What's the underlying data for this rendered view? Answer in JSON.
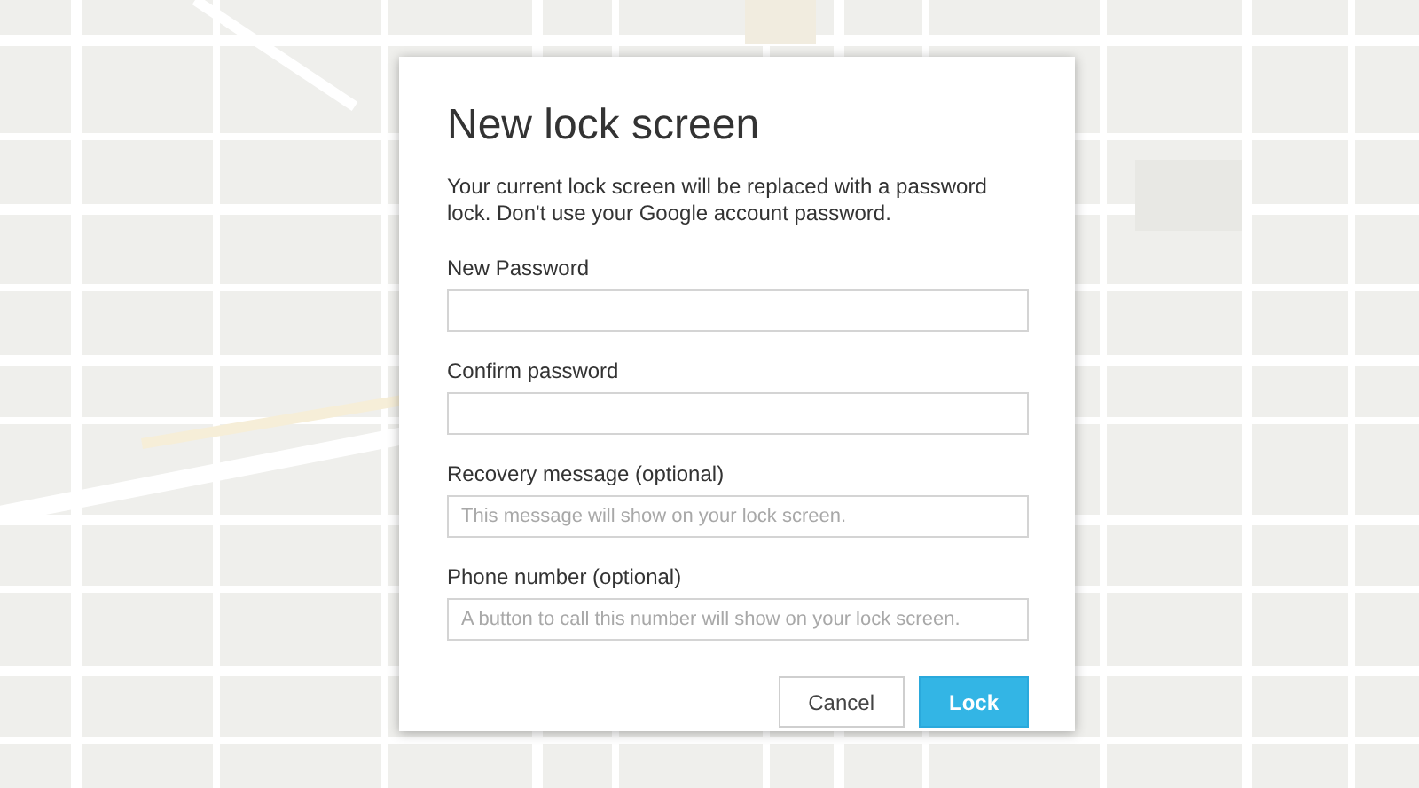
{
  "dialog": {
    "title": "New lock screen",
    "description": "Your current lock screen will be replaced with a password lock. Don't use your Google account password.",
    "fields": [
      {
        "label": "New Password"
      },
      {
        "label": "Confirm password"
      },
      {
        "label": "Recovery message (optional)",
        "placeholder": "This message will show on your lock screen."
      },
      {
        "label": "Phone number (optional)",
        "placeholder": "A button to call this number will show on your lock screen."
      }
    ],
    "buttons": [
      {
        "label": "Cancel",
        "kind": "secondary"
      },
      {
        "label": "Lock",
        "kind": "primary"
      }
    ]
  }
}
